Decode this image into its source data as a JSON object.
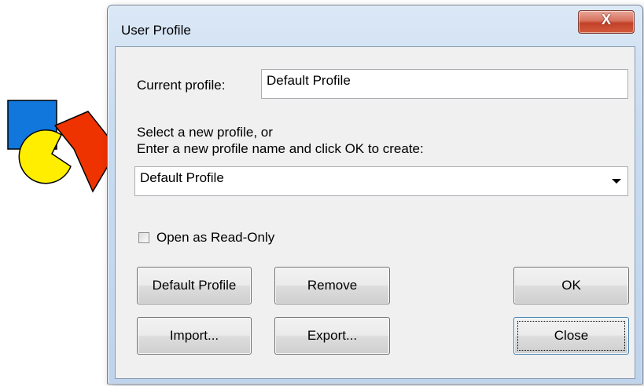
{
  "window": {
    "title": "User Profile",
    "close_glyph": "X"
  },
  "current_profile": {
    "label": "Current profile:",
    "value": "Default Profile"
  },
  "select": {
    "instruction_line1": "Select a new profile, or",
    "instruction_line2": "Enter a new profile name and click OK to create:",
    "selected_value": "Default Profile"
  },
  "read_only": {
    "label": "Open as Read-Only",
    "checked": false
  },
  "buttons": {
    "default_profile": "Default Profile",
    "remove": "Remove",
    "ok": "OK",
    "import": "Import...",
    "export": "Export...",
    "close": "Close"
  },
  "colors": {
    "logo_blue": "#1177dd",
    "logo_yellow": "#ffee00",
    "logo_red": "#ee3300"
  }
}
